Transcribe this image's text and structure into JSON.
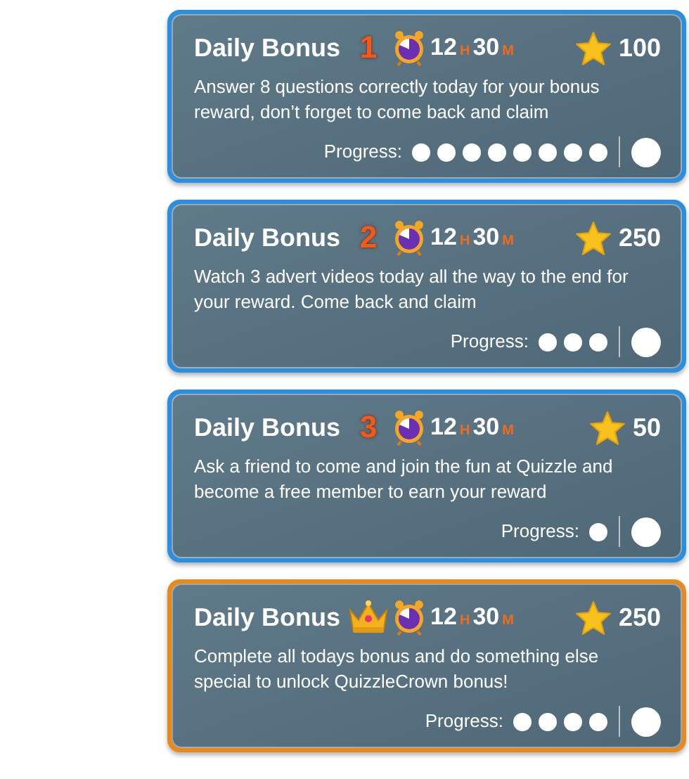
{
  "bonuses": [
    {
      "title": "Daily Bonus",
      "badge": {
        "kind": "number",
        "text": "1"
      },
      "hours": "12",
      "hours_unit": "H",
      "minutes": "30",
      "minutes_unit": "M",
      "reward": "100",
      "description": "Answer 8 questions correctly today for your bonus reward, don’t forget to come back and claim",
      "progress_label": "Progress:",
      "steps": [
        {
          "kind": "dot"
        },
        {
          "kind": "dot"
        },
        {
          "kind": "dot"
        },
        {
          "kind": "dot"
        },
        {
          "kind": "dot"
        },
        {
          "kind": "dot"
        },
        {
          "kind": "dot"
        },
        {
          "kind": "dot"
        }
      ],
      "color": "#2a8fe0"
    },
    {
      "title": "Daily Bonus",
      "badge": {
        "kind": "number",
        "text": "2"
      },
      "hours": "12",
      "hours_unit": "H",
      "minutes": "30",
      "minutes_unit": "M",
      "reward": "250",
      "description": "Watch 3 advert videos today all the way to the end for your reward. Come back and claim",
      "progress_label": "Progress:",
      "steps": [
        {
          "kind": "dot"
        },
        {
          "kind": "dot"
        },
        {
          "kind": "dot"
        }
      ],
      "color": "#2a8fe0"
    },
    {
      "title": "Daily Bonus",
      "badge": {
        "kind": "number",
        "text": "3"
      },
      "hours": "12",
      "hours_unit": "H",
      "minutes": "30",
      "minutes_unit": "M",
      "reward": "50",
      "description": "Ask a friend to come and join the fun at Quizzle and become a free member to earn your reward",
      "progress_label": "Progress:",
      "steps": [
        {
          "kind": "dot"
        }
      ],
      "color": "#2a8fe0"
    },
    {
      "title": "Daily Bonus",
      "badge": {
        "kind": "crown"
      },
      "hours": "12",
      "hours_unit": "H",
      "minutes": "30",
      "minutes_unit": "M",
      "reward": "250",
      "description": "Complete all todays bonus and do something else special to unlock QuizzleCrown bonus!",
      "progress_label": "Progress:",
      "steps": [
        {
          "kind": "dot"
        },
        {
          "kind": "dot"
        },
        {
          "kind": "dot"
        },
        {
          "kind": "dot"
        }
      ],
      "color": "#e8891c"
    }
  ]
}
